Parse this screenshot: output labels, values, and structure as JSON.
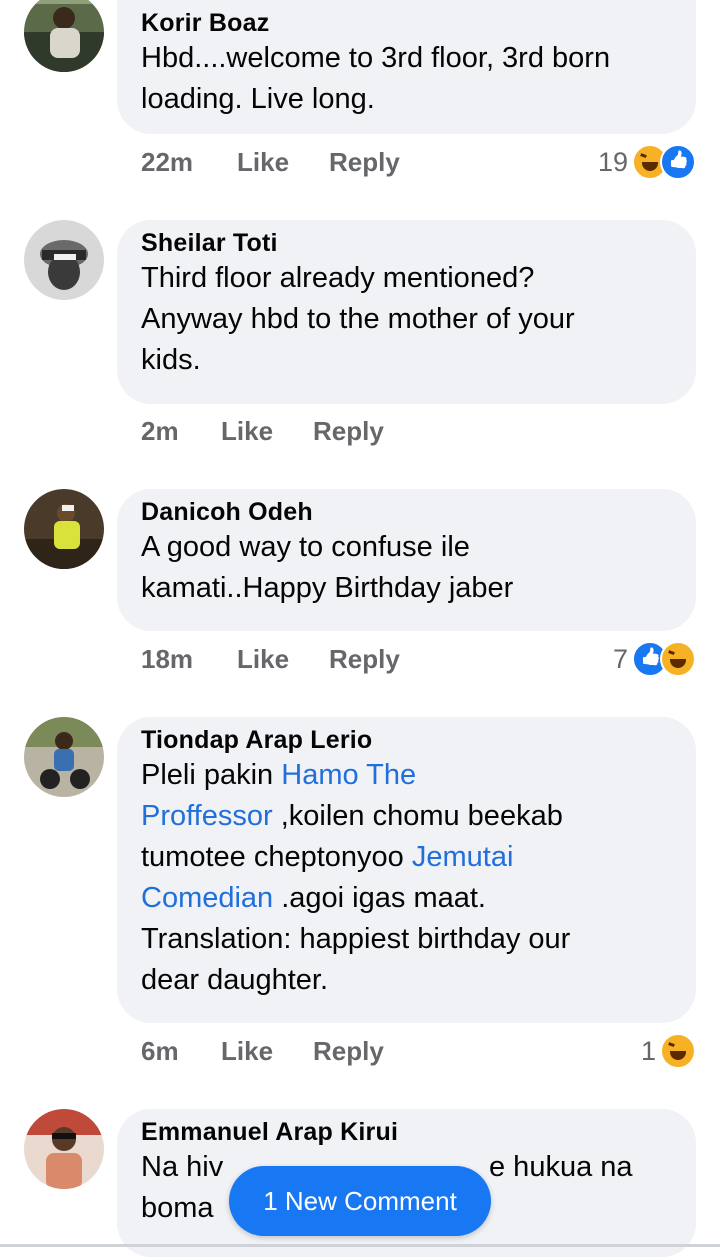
{
  "comments": [
    {
      "author": "Korir Boaz",
      "lines": [
        "Hbd....welcome to 3rd floor, 3rd born",
        "loading. Live long."
      ],
      "time": "22m",
      "like_label": "Like",
      "reply_label": "Reply",
      "reaction_count": "19",
      "reactions": [
        "haha-icon",
        "like-icon"
      ]
    },
    {
      "author": "Sheilar Toti",
      "lines": [
        "Third floor already mentioned?",
        "Anyway hbd to the mother of your",
        "kids."
      ],
      "time": "2m",
      "like_label": "Like",
      "reply_label": "Reply"
    },
    {
      "author": "Danicoh Odeh",
      "lines": [
        "A good way to confuse ile",
        "kamati..Happy Birthday jaber"
      ],
      "time": "18m",
      "like_label": "Like",
      "reply_label": "Reply",
      "reaction_count": "7",
      "reactions": [
        "like-icon",
        "haha-icon"
      ]
    },
    {
      "author": "Tiondap Arap Lerio",
      "segments": {
        "l1a": "Pleli pakin ",
        "l1m": "Hamo The",
        "l2m": "Proffessor",
        "l2b": " ,koilen chomu beekab",
        "l3a": "tumotee cheptonyoo ",
        "l3m": "Jemutai",
        "l4m": "Comedian",
        "l4b": " .agoi igas maat.",
        "l5": "Translation: happiest birthday our",
        "l6": "dear daughter."
      },
      "time": "6m",
      "like_label": "Like",
      "reply_label": "Reply",
      "reaction_count": "1",
      "reactions": [
        "haha-icon"
      ]
    },
    {
      "author": "Emmanuel Arap Kirui",
      "segments": {
        "l1a": "Na hiv",
        "l1b": "e hukua na",
        "l2a": "boma"
      }
    }
  ],
  "new_comment_banner": "1 New Comment",
  "colors": {
    "bubble": "#f0f2f5",
    "mention": "#216fdb",
    "accent": "#1877f2",
    "meta": "#65676b"
  }
}
